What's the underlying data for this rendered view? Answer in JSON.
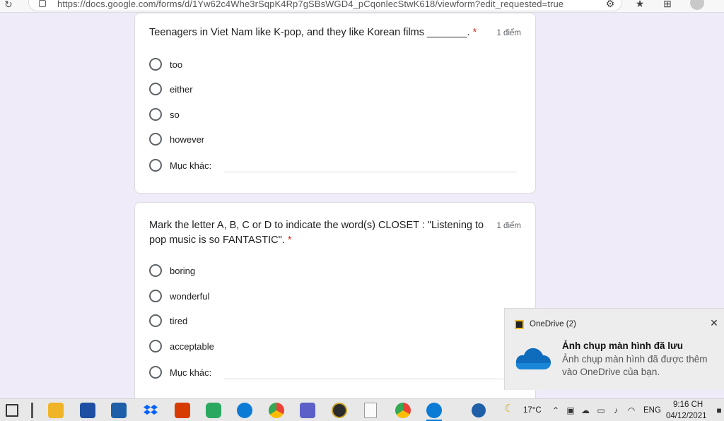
{
  "browser": {
    "url": "https://docs.google.com/forms/d/1Yw62c4Whe3rSqpK4Rp7gSBsWGD4_pCqonlecStwK618/viewform?edit_requested=true"
  },
  "questions": [
    {
      "title": "Teenagers in Viet Nam like K-pop, and they like Korean films _______.",
      "required_mark": "*",
      "points": "1 điểm",
      "options": [
        "too",
        "either",
        "so",
        "however"
      ],
      "other_label": "Mục khác:"
    },
    {
      "title_line1": "Mark the letter A, B, C or D to indicate the word(s) CLOSET : \"Listening to",
      "title_line2": "pop music is so FANTASTIC\".",
      "required_mark": "*",
      "points": "1 điểm",
      "options": [
        "boring",
        "wonderful",
        "tired",
        "acceptable"
      ],
      "other_label": "Mục khác:"
    }
  ],
  "toast": {
    "app": "OneDrive (2)",
    "title": "Ảnh chụp màn hình đã lưu",
    "body": "Ảnh chụp màn hình đã được thêm vào OneDrive của bạn."
  },
  "taskbar": {
    "weather": "17°C",
    "language": "ENG",
    "time": "9:16 CH",
    "date": "04/12/2021"
  },
  "colors": {
    "page_bg": "#f0ebf8",
    "required": "#d93025",
    "onedrive_blue": "#0f6cbd"
  }
}
